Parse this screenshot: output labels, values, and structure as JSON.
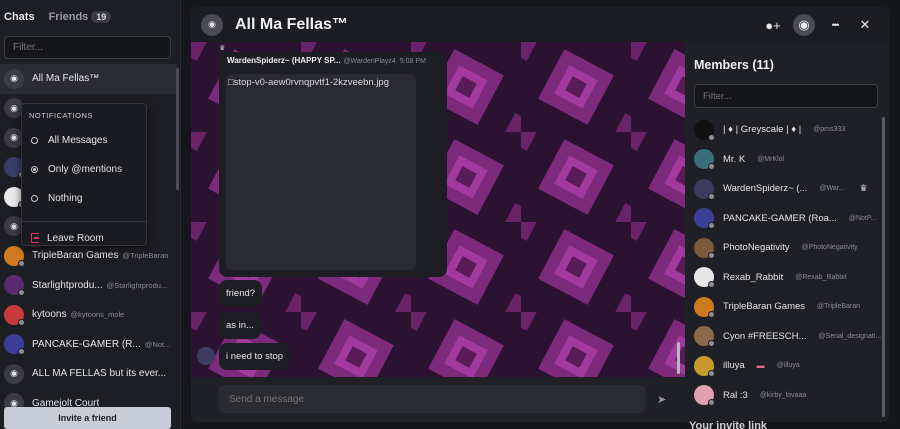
{
  "sidebar": {
    "tabs": [
      {
        "label": "Chats"
      },
      {
        "label": "Friends",
        "badge": "19"
      }
    ],
    "filter_placeholder": "Filter...",
    "chats": [
      {
        "name": "All Ma Fellas™",
        "handle": "",
        "active": true
      },
      {
        "name": "",
        "handle": ""
      },
      {
        "name": "",
        "handle": ""
      },
      {
        "name": "",
        "handle": ""
      },
      {
        "name": "",
        "handle": ""
      },
      {
        "name": "",
        "handle": ""
      },
      {
        "name": "TripleBaran Games",
        "handle": "@TripleBaran"
      },
      {
        "name": "Starlightprodu...",
        "handle": "@Starlightprodu..."
      },
      {
        "name": "kytoons",
        "handle": "@kytoons_mole"
      },
      {
        "name": "PANCAKE-GAMER (R...",
        "handle": "@Not..."
      },
      {
        "name": "ALL MA FELLAS but its ever...",
        "handle": ""
      },
      {
        "name": "Gamejolt Court",
        "handle": ""
      }
    ],
    "invite_label": "Invite a friend"
  },
  "notifications": {
    "title": "NOTIFICATIONS",
    "options": [
      {
        "label": "All Messages",
        "selected": false
      },
      {
        "label": "Only @mentions",
        "selected": true
      },
      {
        "label": "Nothing",
        "selected": false
      }
    ],
    "leave_label": "Leave Room"
  },
  "window": {
    "title": "All Ma Fellas™",
    "close_glyph": "✕",
    "more_glyph": "•••"
  },
  "message": {
    "author": "WardenSpiderz~ (HAPPY SP...",
    "handle": "@WardenPlayz4",
    "time": "5:08 PM",
    "image_alt": "stop-v0-aew0rvnqpvtf1-2kzveebn.jpg",
    "bubbles": [
      "friend?",
      "as in...",
      "i need to stop"
    ]
  },
  "compose": {
    "placeholder": "Send a message"
  },
  "members": {
    "title": "Members (11)",
    "filter_placeholder": "Filter...",
    "list": [
      {
        "name": "| ♦ | Greyscale | ♦ |",
        "handle": "@pms333"
      },
      {
        "name": "Mr. K",
        "handle": "@MrKlol"
      },
      {
        "name": "WardenSpiderz~ (...",
        "handle": "@War...",
        "crown": true
      },
      {
        "name": "PANCAKE-GAMER (Roa...",
        "handle": "@NotP..."
      },
      {
        "name": "PhotoNegativity",
        "handle": "@PhotoNegativity"
      },
      {
        "name": "Rexab_Rabbit",
        "handle": "@Rexab_Rabbit"
      },
      {
        "name": "TripleBaran Games",
        "handle": "@TripleBaran"
      },
      {
        "name": "Cyon #FREESCH...",
        "handle": "@Serial_designati..."
      },
      {
        "name": "illuya",
        "handle": "@illuya"
      },
      {
        "name": "Ral :3",
        "handle": "@kirby_lovaaa"
      },
      {
        "name": "",
        "handle": ""
      }
    ]
  },
  "under": {
    "invite_text": "Your invite link"
  },
  "colors": {
    "accent_leave": "#e0355a",
    "chat_bg": "#2b1230",
    "pattern": "#8e2f8a"
  }
}
